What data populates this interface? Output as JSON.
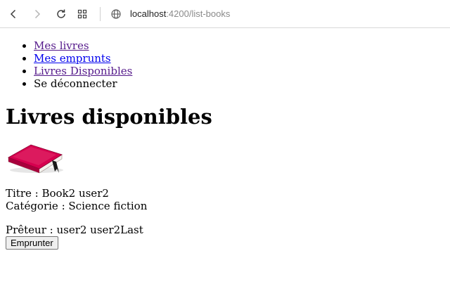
{
  "browser": {
    "url_host": "localhost",
    "url_path": ":4200/list-books"
  },
  "nav": {
    "items": [
      {
        "label": "Mes livres"
      },
      {
        "label": "Mes emprunts"
      },
      {
        "label": "Livres Disponibles"
      },
      {
        "label": "Se déconnecter"
      }
    ]
  },
  "page": {
    "title": "Livres disponibles"
  },
  "book": {
    "image_icon": "book-icon",
    "title_line": "Titre : Book2 user2",
    "category_line": "Catégorie : Science fiction",
    "lender_line": "Prêteur : user2 user2Last",
    "borrow_label": "Emprunter"
  },
  "colors": {
    "link": "#0000ee",
    "visited_link": "#551a8b",
    "book_cover": "#d6004f"
  }
}
